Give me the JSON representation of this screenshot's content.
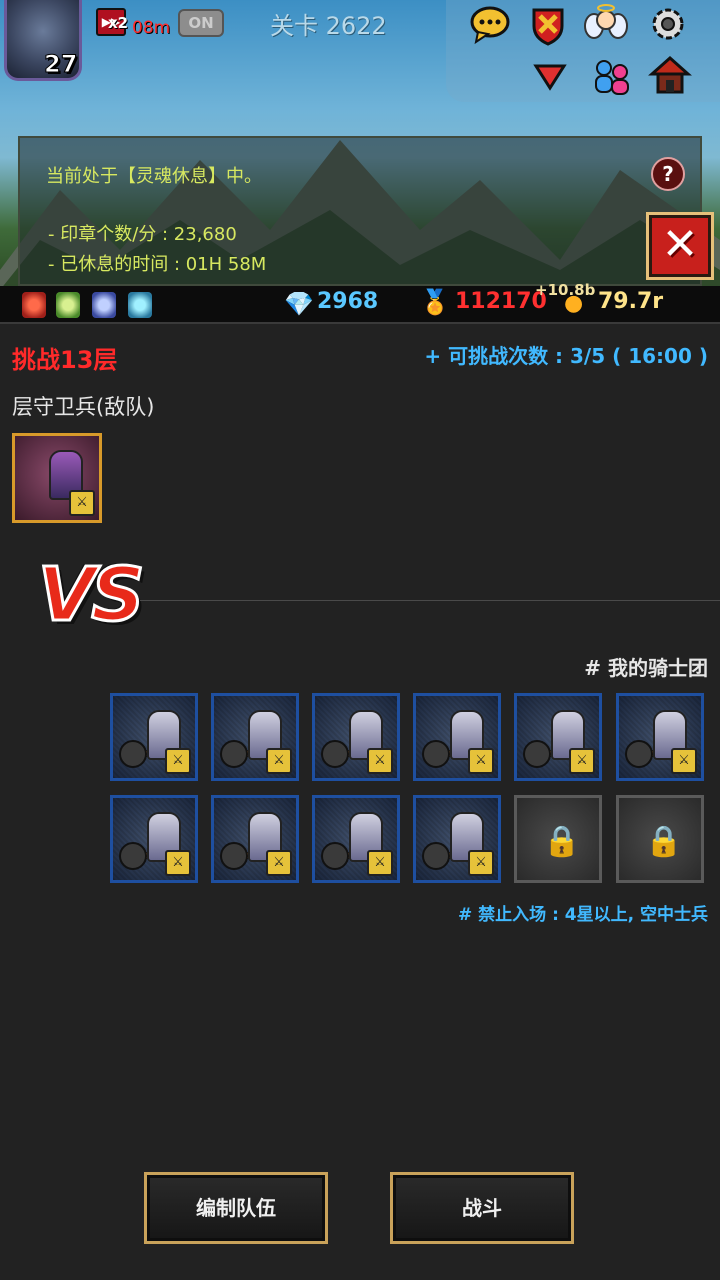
{
  "hud": {
    "player_level": "27",
    "speed_multiplier": "x2",
    "speed_time": "08m",
    "auto_toggle": "ON",
    "stage_label": "关卡 2622"
  },
  "rest_panel": {
    "status": "当前处于【灵魂休息】中。",
    "seals_per_min": "- 印章个数/分 : 23,680",
    "rest_time": "- 已休息的时间 : 01H 58M",
    "help_symbol": "?",
    "close_symbol": "✕"
  },
  "resources": {
    "gems": "2968",
    "medals": "112170",
    "bonus_rate": "+10.8b",
    "coins": "79.7r"
  },
  "challenge": {
    "title": "挑战13层",
    "attempts": "+ 可挑战次数 : 3/5 ( 16:00 )",
    "guard_heading": "层守卫兵(敌队)",
    "vs": "VS",
    "team_heading": "# 我的骑士团",
    "ban_rule": "# 禁止入场 : 4星以上, 空中士兵"
  },
  "team": {
    "filled_slots": 10,
    "locked_slots": 2
  },
  "buttons": {
    "edit_team": "编制队伍",
    "battle": "战斗"
  },
  "icons": {
    "chat": "chat-icon",
    "shield": "shield-icon",
    "angel": "angel-icon",
    "settings": "gear-icon",
    "dropdown": "triangle-down-icon",
    "friends": "friends-icon",
    "house": "house-icon",
    "gem": "diamond-icon",
    "medal": "medal-icon",
    "coin": "coin-icon",
    "lock": "lock-icon"
  },
  "colors": {
    "accent_red": "#ff2a2a",
    "accent_blue": "#41b9ff",
    "button_border": "#c9a25a",
    "info_text": "#d7e860"
  }
}
